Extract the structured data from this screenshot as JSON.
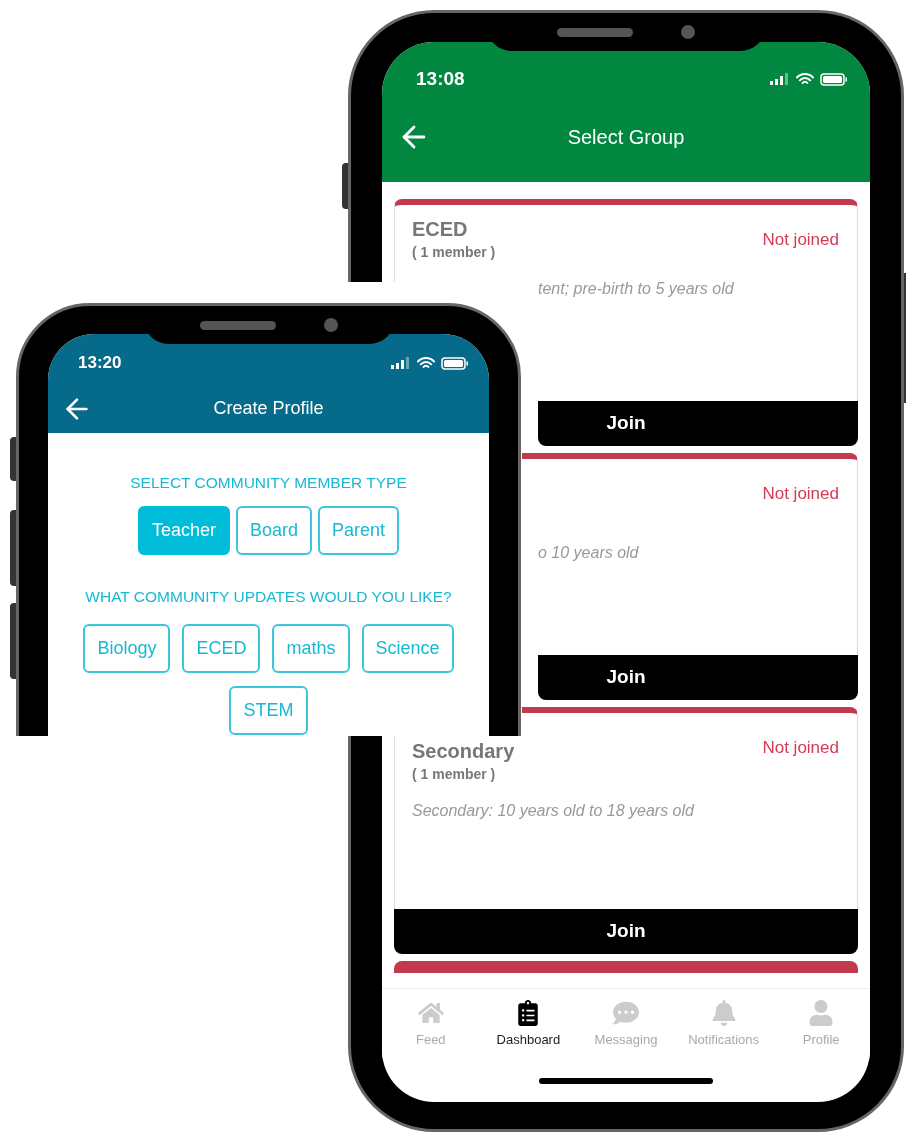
{
  "back_phone": {
    "status_bar": {
      "time": "13:08"
    },
    "header": {
      "title": "Select Group"
    },
    "groups": [
      {
        "title": "ECED",
        "members": "( 1 member )",
        "description": "tent; pre-birth to 5 years old",
        "status": "Not joined",
        "button": "Join"
      },
      {
        "description": "o 10 years old",
        "status": "Not joined",
        "button": "Join"
      },
      {
        "title": "Secondary",
        "members": "( 1 member )",
        "description": "Secondary: 10 years old to 18 years old",
        "status": "Not joined",
        "button": "Join"
      }
    ],
    "tab_bar": [
      {
        "label": "Feed",
        "kind": "home",
        "selected": false
      },
      {
        "label": "Dashboard",
        "kind": "clipboard",
        "selected": true
      },
      {
        "label": "Messaging",
        "kind": "chat",
        "selected": false
      },
      {
        "label": "Notifications",
        "kind": "bell",
        "selected": false
      },
      {
        "label": "Profile",
        "kind": "person",
        "selected": false
      }
    ]
  },
  "front_phone": {
    "status_bar": {
      "time": "13:20"
    },
    "header": {
      "title": "Create Profile"
    },
    "member_type": {
      "heading": "SELECT COMMUNITY MEMBER TYPE",
      "options": [
        {
          "label": "Teacher",
          "selected": true
        },
        {
          "label": "Board",
          "selected": false
        },
        {
          "label": "Parent",
          "selected": false
        }
      ]
    },
    "updates": {
      "heading": "WHAT COMMUNITY UPDATES WOULD YOU LIKE?",
      "options": [
        {
          "label": "Biology",
          "selected": false
        },
        {
          "label": "ECED",
          "selected": false
        },
        {
          "label": "maths",
          "selected": false
        },
        {
          "label": "Science",
          "selected": false
        },
        {
          "label": "STEM",
          "selected": false
        }
      ]
    }
  }
}
